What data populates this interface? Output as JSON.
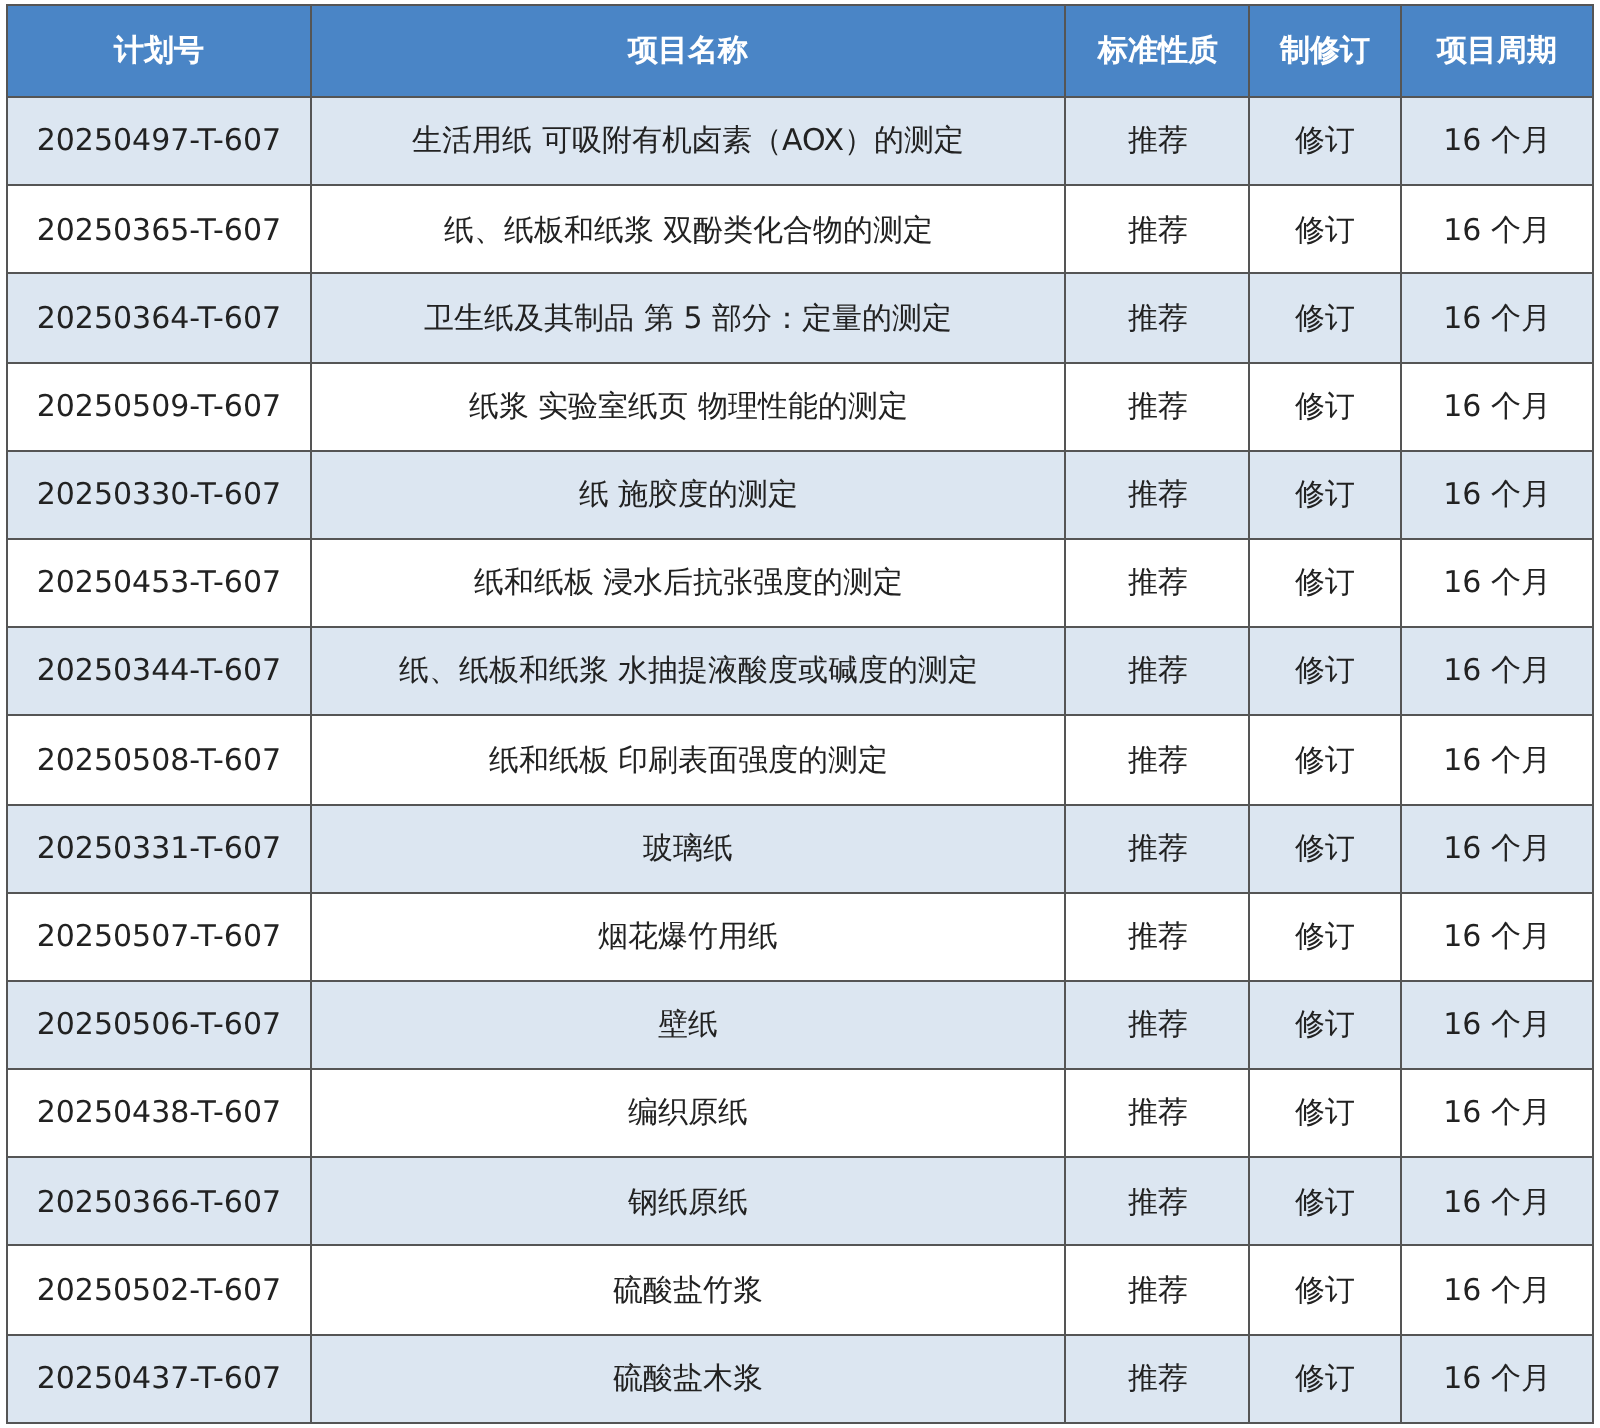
{
  "table": {
    "columns": [
      "计划号",
      "项目名称",
      "标准性质",
      "制修订",
      "项目周期"
    ],
    "rows": [
      [
        "20250497-T-607",
        "生活用纸 可吸附有机卤素（AOX）的测定",
        "推荐",
        "修订",
        "16 个月"
      ],
      [
        "20250365-T-607",
        "纸、纸板和纸浆 双酚类化合物的测定",
        "推荐",
        "修订",
        "16 个月"
      ],
      [
        "20250364-T-607",
        "卫生纸及其制品 第 5 部分：定量的测定",
        "推荐",
        "修订",
        "16 个月"
      ],
      [
        "20250509-T-607",
        "纸浆 实验室纸页 物理性能的测定",
        "推荐",
        "修订",
        "16 个月"
      ],
      [
        "20250330-T-607",
        "纸 施胶度的测定",
        "推荐",
        "修订",
        "16 个月"
      ],
      [
        "20250453-T-607",
        "纸和纸板 浸水后抗张强度的测定",
        "推荐",
        "修订",
        "16 个月"
      ],
      [
        "20250344-T-607",
        "纸、纸板和纸浆 水抽提液酸度或碱度的测定",
        "推荐",
        "修订",
        "16 个月"
      ],
      [
        "20250508-T-607",
        "纸和纸板 印刷表面强度的测定",
        "推荐",
        "修订",
        "16 个月"
      ],
      [
        "20250331-T-607",
        "玻璃纸",
        "推荐",
        "修订",
        "16 个月"
      ],
      [
        "20250507-T-607",
        "烟花爆竹用纸",
        "推荐",
        "修订",
        "16 个月"
      ],
      [
        "20250506-T-607",
        "壁纸",
        "推荐",
        "修订",
        "16 个月"
      ],
      [
        "20250438-T-607",
        "编织原纸",
        "推荐",
        "修订",
        "16 个月"
      ],
      [
        "20250366-T-607",
        "钢纸原纸",
        "推荐",
        "修订",
        "16 个月"
      ],
      [
        "20250502-T-607",
        "硫酸盐竹浆",
        "推荐",
        "修订",
        "16 个月"
      ],
      [
        "20250437-T-607",
        "硫酸盐木浆",
        "推荐",
        "修订",
        "16 个月"
      ]
    ]
  }
}
